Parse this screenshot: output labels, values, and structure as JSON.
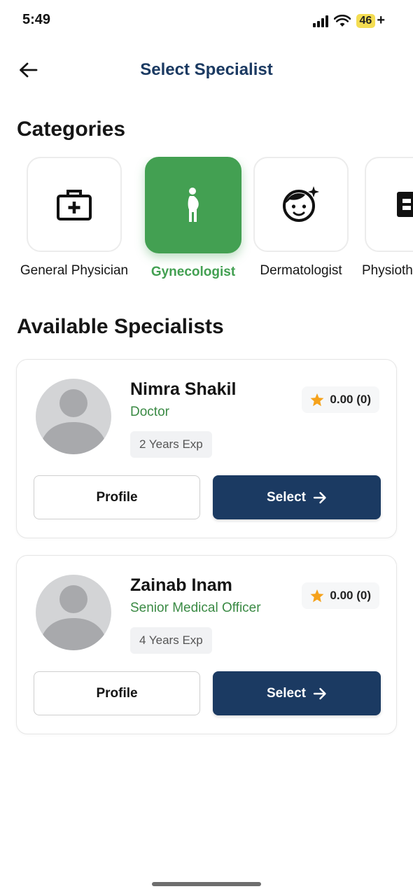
{
  "status_bar": {
    "time": "5:49",
    "battery": "46",
    "battery_charging": "+"
  },
  "header": {
    "title": "Select Specialist",
    "back_icon": "arrow-left-icon"
  },
  "sections": {
    "categories": "Categories",
    "specialists": "Available Specialists"
  },
  "categories": [
    {
      "label": "General Physician",
      "icon": "medical-kit-icon",
      "active": false
    },
    {
      "label": "Gynecologist",
      "icon": "pregnant-woman-icon",
      "active": true
    },
    {
      "label": "Dermatologist",
      "icon": "face-sparkle-icon",
      "active": false
    },
    {
      "label": "Physiotherapist",
      "icon": "physio-icon",
      "active": false
    }
  ],
  "specialists": [
    {
      "name": "Nimra Shakil",
      "role": "Doctor",
      "experience": "2 Years Exp",
      "rating": "0.00 (0)",
      "profile_label": "Profile",
      "select_label": "Select"
    },
    {
      "name": "Zainab Inam",
      "role": "Senior Medical Officer",
      "experience": "4 Years Exp",
      "rating": "0.00 (0)",
      "profile_label": "Profile",
      "select_label": "Select"
    }
  ],
  "colors": {
    "accent_green": "#43a052",
    "primary_navy": "#1b3a62",
    "star": "#f5a21b"
  }
}
